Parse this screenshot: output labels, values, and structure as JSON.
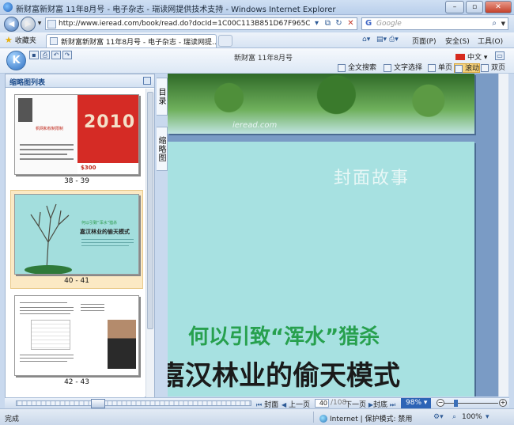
{
  "window": {
    "title": "新财富新财富 11年8月号 - 电子杂志 - 瑞读网提供技术支持 - Windows Internet Explorer",
    "controls": {
      "min": "–",
      "max": "▫",
      "close": "✕"
    }
  },
  "address": {
    "url": "http://www.ieread.com/book/read.do?docId=1C00C113B851D67F965CF0F514AE4139",
    "search_placeholder": "Google"
  },
  "favorites": {
    "label": "收藏夹",
    "tab_title": "新财富新财富 11年8月号 - 电子杂志 - 瑞读网提...",
    "commands": [
      "页面(P)",
      "安全(S)",
      "工具(O)"
    ]
  },
  "reader": {
    "logo": "K",
    "title": "新财富 11年8月号",
    "language": "中文",
    "buttons": [
      "全文搜索",
      "文字选择",
      "单页",
      "滚动",
      "双页"
    ]
  },
  "thumbnails": {
    "header": "缩略图列表",
    "items": [
      {
        "pages": "38 - 39",
        "selected": false,
        "text_left": "帆网和权制限制",
        "text_right": "2010",
        "badge": "$300"
      },
      {
        "pages": "40 - 41",
        "selected": true,
        "text_small": "何以引致“浑水”猎杀",
        "text_main": "嘉汉林业的偷天模式"
      },
      {
        "pages": "42 - 43",
        "selected": false
      }
    ]
  },
  "side_tabs": {
    "toc": "目录",
    "thumbs": "缩略图"
  },
  "main": {
    "watermark": "ieread.com",
    "cover_story": "封面故事",
    "headline_small": "何以引致“浑水”猎杀",
    "headline_main": "嘉汉林业的偷天模式"
  },
  "navigation": {
    "first": "封面",
    "prev": "上一页",
    "current_page": "40",
    "total": "/108",
    "next": "下一页",
    "last": "封底",
    "zoom": "98%",
    "zoom_level": 0.2
  },
  "status": {
    "text": "完成",
    "zone": "Internet | 保护模式: 禁用",
    "zoom": "100%"
  }
}
